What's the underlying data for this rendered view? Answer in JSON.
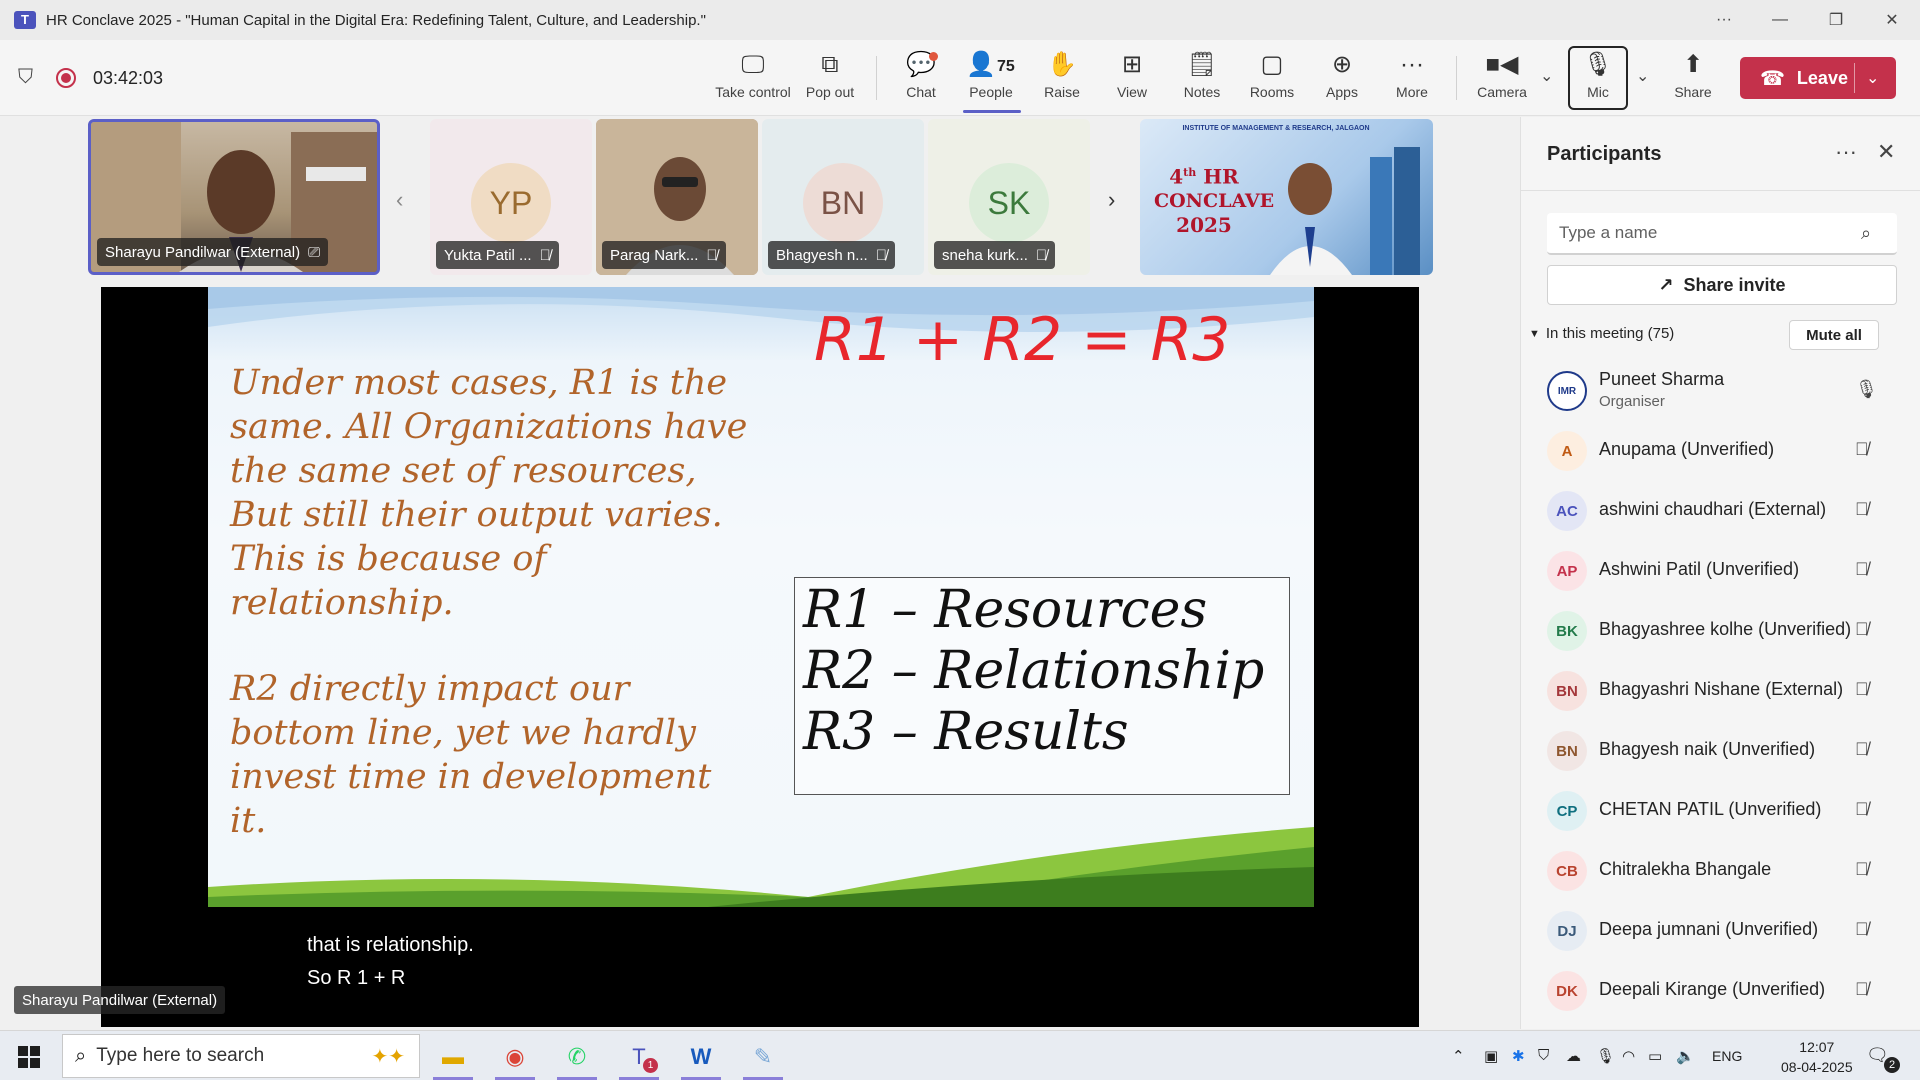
{
  "window": {
    "title": "HR Conclave 2025 - \"Human Capital in the Digital Era: Redefining Talent, Culture, and Leadership.\"",
    "app_icon": "teams-icon"
  },
  "toolbar": {
    "timer": "03:42:03",
    "take_control": "Take control",
    "pop_out": "Pop out",
    "chat": "Chat",
    "people": "People",
    "people_count": "75",
    "raise": "Raise",
    "view": "View",
    "notes": "Notes",
    "rooms": "Rooms",
    "apps": "Apps",
    "more": "More",
    "camera": "Camera",
    "mic": "Mic",
    "share": "Share",
    "leave": "Leave",
    "accent_color": "#5b5fc7",
    "leave_color": "#c4314b"
  },
  "gallery": {
    "tiles": [
      {
        "name": "Sharayu Pandilwar (External)"
      },
      {
        "name": "Yukta Patil ...",
        "initials": "YP"
      },
      {
        "name": "Parag Nark..."
      },
      {
        "name": "Bhagyesh n...",
        "initials": "BN"
      },
      {
        "name": "sneha kurk...",
        "initials": "SK"
      }
    ],
    "conclave_poster": {
      "line1": "4",
      "line1_sup": "th",
      "line2": "HR",
      "line3": "CONCLAVE",
      "line4": "2025",
      "header": "INSTITUTE OF MANAGEMENT & RESEARCH, JALGAON"
    }
  },
  "slide": {
    "equation": "R1 + R2 = R3",
    "para1": "Under most cases, R1 is the\nsame. All Organizations have\nthe same set of resources,\nBut still their output varies.\nThis is because of\nrelationship.",
    "para2": "R2 directly impact our\nbottom line, yet we hardly\ninvest time in development\nit.",
    "legend": [
      "R1 – Resources",
      "R2 – Relationship",
      "R3 – Results"
    ]
  },
  "captions": {
    "line1": "that is relationship.",
    "line2": "So R 1 + R"
  },
  "speaker_label": "Sharayu Pandilwar (External)",
  "panel": {
    "title": "Participants",
    "search_placeholder": "Type a name",
    "share_invite": "Share invite",
    "in_meeting": "In this meeting (75)",
    "mute_all": "Mute all",
    "participants": [
      {
        "initials": "IMR",
        "name": "Puneet Sharma",
        "role": "Organiser",
        "bg": "#ffffff",
        "fg": "#1f3a8a",
        "mic": "mic-on"
      },
      {
        "initials": "A",
        "name": "Anupama (Unverified)",
        "bg": "#fdeee0",
        "fg": "#c05a14",
        "mic": "mic-off"
      },
      {
        "initials": "AC",
        "name": "ashwini chaudhari (External)",
        "bg": "#e3e6f5",
        "fg": "#4b53bc",
        "mic": "mic-off"
      },
      {
        "initials": "AP",
        "name": "Ashwini Patil (Unverified)",
        "bg": "#fbe3e6",
        "fg": "#c4314b",
        "mic": "mic-off"
      },
      {
        "initials": "BK",
        "name": "Bhagyashree kolhe (Unverified)",
        "bg": "#e0f3e7",
        "fg": "#237b4b",
        "mic": "mic-off"
      },
      {
        "initials": "BN",
        "name": "Bhagyashri Nishane (External)",
        "bg": "#f7e2df",
        "fg": "#a4373a",
        "mic": "mic-off"
      },
      {
        "initials": "BN",
        "name": "Bhagyesh naik (Unverified)",
        "bg": "#f1e6e4",
        "fg": "#8e562e",
        "mic": "mic-off"
      },
      {
        "initials": "CP",
        "name": "CHETAN PATIL (Unverified)",
        "bg": "#dff0f3",
        "fg": "#0f6f7f",
        "mic": "mic-off"
      },
      {
        "initials": "CB",
        "name": "Chitralekha Bhangale",
        "bg": "#fbe3e3",
        "fg": "#b9432f",
        "mic": "mic-off"
      },
      {
        "initials": "DJ",
        "name": "Deepa jumnani (Unverified)",
        "bg": "#e6ecf3",
        "fg": "#3b5a7a",
        "mic": "mic-off"
      },
      {
        "initials": "DK",
        "name": "Deepali Kirange (Unverified)",
        "bg": "#fbe3e3",
        "fg": "#b9432f",
        "mic": "mic-off"
      }
    ]
  },
  "taskbar": {
    "search_placeholder": "Type here to search",
    "language": "ENG",
    "time": "12:07",
    "date": "08-04-2025",
    "teams_badge": "1",
    "notification_count": "2"
  }
}
